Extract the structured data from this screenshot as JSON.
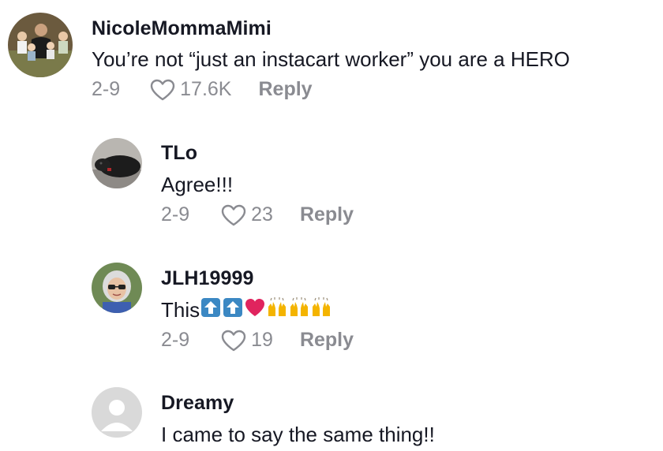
{
  "comments": [
    {
      "username": "NicoleMommaMimi",
      "text": "You’re not “just an instacart worker” you are a HERO",
      "date": "2-9",
      "likes": "17.6K",
      "reply_label": "Reply"
    },
    {
      "username": "TLo",
      "text": "Agree!!!",
      "date": "2-9",
      "likes": "23",
      "reply_label": "Reply"
    },
    {
      "username": "JLH19999",
      "text": "This",
      "emojis": [
        "up-arrow-emoji",
        "up-arrow-emoji",
        "red-heart-emoji",
        "raising-hands-emoji",
        "raising-hands-emoji",
        "raising-hands-emoji"
      ],
      "date": "2-9",
      "likes": "19",
      "reply_label": "Reply"
    },
    {
      "username": "Dreamy",
      "text": "I came to say the same thing!!"
    }
  ],
  "colors": {
    "username": "#161823",
    "text": "#161823",
    "meta": "#8a8b91",
    "heart_emoji": "#e0245e",
    "arrow_emoji": "#3b88c3",
    "hands_emoji": "#f4b400",
    "default_avatar": "#d9d9d9"
  }
}
